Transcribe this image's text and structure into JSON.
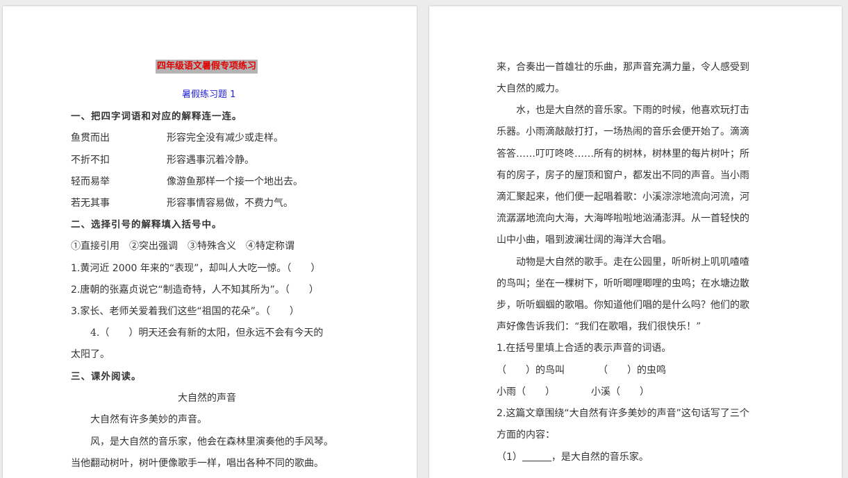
{
  "left_page": {
    "title": "四年级语文暑假专项练习",
    "subtitle": "暑假练习题 1",
    "section1": {
      "heading": "一、把四字词语和对应的解释连一连。",
      "rows": [
        {
          "term": "鱼贯而出",
          "meaning": "形容完全没有减少或走样。"
        },
        {
          "term": "不折不扣",
          "meaning": "形容遇事沉着冷静。"
        },
        {
          "term": "轻而易举",
          "meaning": "像游鱼那样一个接一个地出去。"
        },
        {
          "term": "若无其事",
          "meaning": "形容事情容易做，不费力气。"
        }
      ]
    },
    "section2": {
      "heading": "二、选择引号的解释填入括号中。",
      "options": "①直接引用　②突出强调　③特殊含义　④特定称谓",
      "q1": "1.黄河近 2000 年来的“表现”，却叫人大吃一惊。（　　）",
      "q2": "2.唐朝的张嘉贞说它“制造奇特，人不知其所为”。（　　）",
      "q3": "3.家长、老师关爱着我们这些“祖国的花朵”。（　　）",
      "q4a": "4.（　　）明天还会有新的太阳，但永远不会有今天的",
      "q4b": "太阳了。"
    },
    "section3": {
      "heading": "三、课外阅读。",
      "passage_title": "大自然的声音",
      "p1": "大自然有许多美妙的声音。",
      "p2": "风，是大自然的音乐家，他会在森林里演奏他的手风琴。",
      "p3": "当他翻动树叶，树叶便像歌手一样，唱出各种不同的歌曲。"
    }
  },
  "right_page": {
    "lines": [
      "来，合奏出一首雄壮的乐曲，那声音充满力量，令人感受到",
      "大自然的威力。",
      "水，也是大自然的音乐家。下雨的时候，他喜欢玩打击",
      "乐器。小雨滴敲敲打打，一场热闹的音乐会便开始了。滴滴",
      "答答……叮叮咚咚……所有的树林，树林里的每片树叶；所",
      "有的房子，房子的屋顶和窗户，都发出不同的声音。当小雨",
      "滴汇聚起来，他们便一起唱着歌：小溪淙淙地流向河流，河",
      "流潺潺地流向大海，大海哗啦啦地汹涌澎湃。从一首轻快的",
      "山中小曲，唱到波澜壮阔的海洋大合唱。",
      "动物是大自然的歌手。走在公园里，听听树上叽叽喳喳",
      "的鸟叫；坐在一棵树下，听听唧哩唧哩的虫鸣；在水塘边散",
      "步，听听蝈蝈的歌唱。你知道他们唱的是什么吗？他们的歌",
      "声好像告诉我们：“我们在歌唱，我们很快乐！”"
    ],
    "q1": "1.在括号里填上合适的表示声音的词语。",
    "q1_row1a": "（　　）的鸟叫",
    "q1_row1b": "（　　）的虫鸣",
    "q1_row2a": "小雨（　　）",
    "q1_row2b": "小溪（　　）",
    "q2a": "2.这篇文章围绕“大自然有许多美妙的声音”这句话写了三个",
    "q2b": "方面的内容：",
    "q2_item_prefix": "（1）",
    "q2_item_suffix": "，是大自然的音乐家。"
  }
}
